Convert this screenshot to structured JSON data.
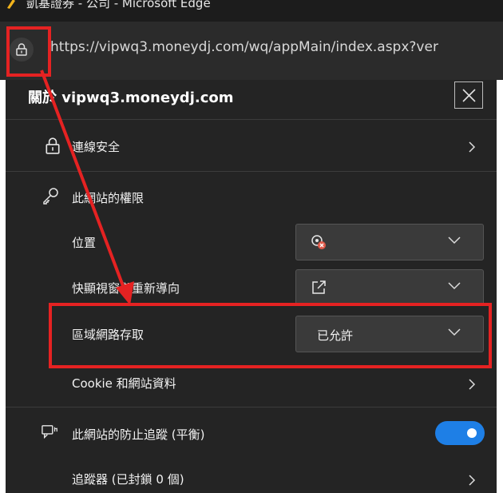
{
  "window": {
    "title": "凱基證券 - 公司 - Microsoft Edge"
  },
  "addressbar": {
    "url": "https://vipwq3.moneydj.com/wq/appMain/index.aspx?ver"
  },
  "panel": {
    "title": "關於 vipwq3.moneydj.com",
    "connection_label": "連線安全",
    "permissions_header": "此網站的權限",
    "location_label": "位置",
    "popups_label": "快顯視窗與重新導向",
    "local_network_label": "區域網路存取",
    "local_network_value": "已允許",
    "cookies_label": "Cookie 和網站資料",
    "tracking_label": "此網站的防止追蹤 (平衡)",
    "trackers_label": "追蹤器 (已封鎖 0 個)",
    "tracking_enabled": true
  },
  "colors": {
    "panel_bg": "#242424",
    "annotation": "#e52222",
    "toggle_on": "#1e7fe6"
  }
}
